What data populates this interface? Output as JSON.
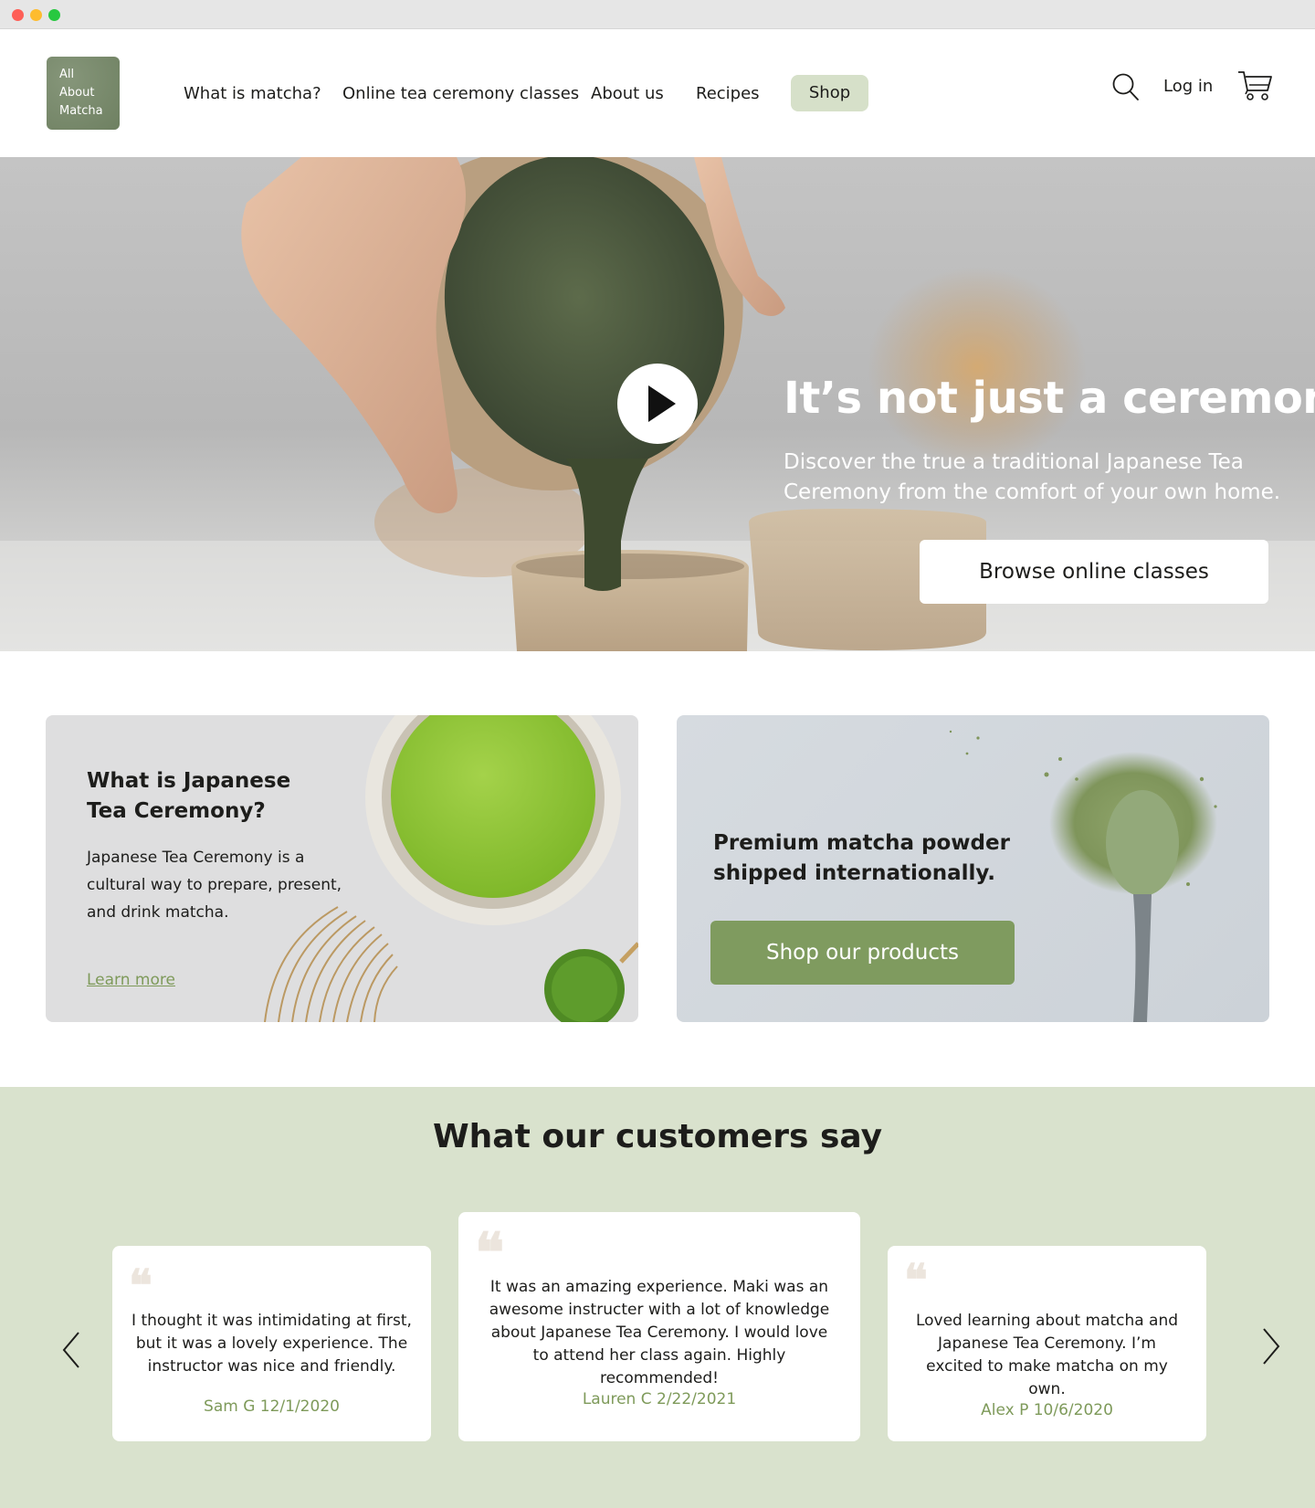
{
  "window": {
    "controls": [
      "close",
      "minimize",
      "maximize"
    ]
  },
  "header": {
    "logo_lines": [
      "All",
      "About",
      "Matcha"
    ],
    "nav": [
      {
        "label": "What is matcha?"
      },
      {
        "label": "Online tea ceremony classes"
      },
      {
        "label": "About us"
      },
      {
        "label": "Recipes"
      }
    ],
    "shop_label": "Shop",
    "login_label": "Log in",
    "icons": {
      "search": "search-icon",
      "cart": "cart-icon"
    }
  },
  "hero": {
    "title": "It’s not just a ceremony.",
    "subtitle": "Discover the true a traditional Japanese Tea Ceremony from the comfort of your own home.",
    "cta_label": "Browse online classes",
    "play_icon": "play-icon"
  },
  "cards": {
    "left": {
      "title_line1": "What is Japanese",
      "title_line2": "Tea Ceremony?",
      "body_line1": "Japanese Tea Ceremony is a",
      "body_line2": "cultural way to prepare, present,",
      "body_line3": "and drink matcha.",
      "link_label": "Learn more"
    },
    "right": {
      "title_line1": "Premium matcha powder",
      "title_line2": "shipped internationally.",
      "cta_label": "Shop our products"
    }
  },
  "testimonials": {
    "heading": "What our customers say",
    "items": [
      {
        "text": "I thought it was intimidating at first, but it was a lovely experience. The instructor was nice and friendly.",
        "author": "Sam G 12/1/2020"
      },
      {
        "text": "It was an amazing experience. Maki was an awesome instructer with a lot of knowledge about Japanese Tea Ceremony. I would love to attend her class again. Highly recommended!",
        "author": "Lauren C 2/22/2021"
      },
      {
        "text": "Loved learning about matcha and Japanese Tea Ceremony. I’m excited to make matcha on my own.",
        "author": "Alex P 10/6/2020"
      }
    ],
    "prev_icon": "chevron-left-icon",
    "next_icon": "chevron-right-icon",
    "quote_glyph": "❝"
  },
  "colors": {
    "accent_green": "#7f9b5f",
    "light_green": "#d9e2cd",
    "pill_green": "#d6e0c9"
  }
}
